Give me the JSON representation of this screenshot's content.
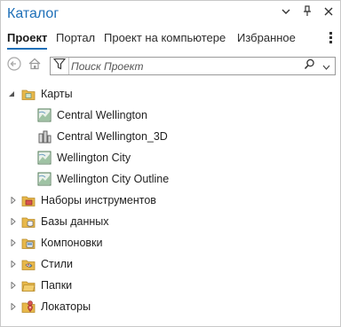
{
  "window": {
    "title": "Каталог",
    "controls": [
      {
        "name": "options-menu",
        "glyph": "▾"
      },
      {
        "name": "pin",
        "glyph": "pin"
      },
      {
        "name": "close",
        "glyph": "✕"
      }
    ]
  },
  "tabs": [
    {
      "label": "Проект",
      "active": true
    },
    {
      "label": "Портал",
      "active": false
    },
    {
      "label": "Проект на компьютере",
      "active": false
    },
    {
      "label": "Избранное",
      "active": false
    }
  ],
  "toolbar": {
    "back_icon": "back-arrow-icon",
    "home_icon": "home-icon",
    "filter_icon": "filter-icon",
    "search": {
      "placeholder": "Поиск Проект",
      "value": ""
    }
  },
  "tree": {
    "maps": {
      "label": "Карты",
      "expanded": true,
      "children": [
        {
          "label": "Central Wellington",
          "icon": "map-icon"
        },
        {
          "label": "Central Wellington_3D",
          "icon": "scene-3d-icon"
        },
        {
          "label": "Wellington City",
          "icon": "map-icon"
        },
        {
          "label": "Wellington City Outline",
          "icon": "map-icon"
        }
      ]
    },
    "folders": [
      {
        "label": "Наборы инструментов",
        "icon": "toolboxes-folder-icon"
      },
      {
        "label": "Базы данных",
        "icon": "databases-folder-icon"
      },
      {
        "label": "Компоновки",
        "icon": "layouts-folder-icon"
      },
      {
        "label": "Стили",
        "icon": "styles-folder-icon"
      },
      {
        "label": "Папки",
        "icon": "folders-folder-icon"
      },
      {
        "label": "Локаторы",
        "icon": "locators-folder-icon"
      }
    ]
  },
  "colors": {
    "accent": "#1d6fb8",
    "folder": "#e8b84a",
    "border": "#c9c9c9"
  }
}
